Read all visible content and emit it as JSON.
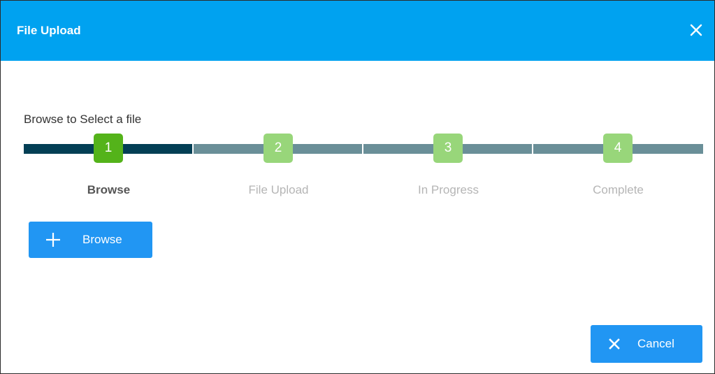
{
  "dialog": {
    "title": "File Upload",
    "close_icon": "close-icon"
  },
  "step_caption": "Browse to Select a file",
  "stepper": {
    "current_step": 1,
    "steps": [
      {
        "number": "1",
        "label": "Browse",
        "state": "active"
      },
      {
        "number": "2",
        "label": "File Upload",
        "state": "inactive"
      },
      {
        "number": "3",
        "label": "In Progress",
        "state": "inactive"
      },
      {
        "number": "4",
        "label": "Complete",
        "state": "inactive"
      }
    ]
  },
  "actions": {
    "browse_label": "Browse",
    "browse_icon": "plus-icon",
    "cancel_label": "Cancel",
    "cancel_icon": "close-icon"
  },
  "colors": {
    "header": "#00a2f0",
    "step_active_bar": "#033f55",
    "step_inactive_bar": "#6a8f98",
    "step_active_box": "#54b31a",
    "step_inactive_box": "#98d67a",
    "button": "#2196f3"
  }
}
